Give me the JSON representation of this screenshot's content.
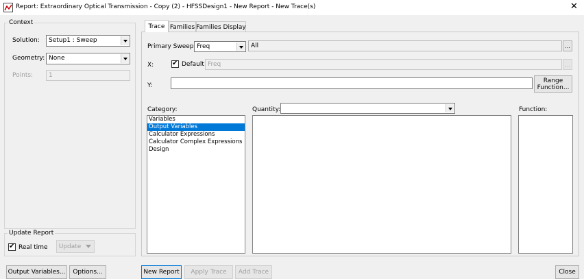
{
  "window": {
    "title": "Report: Extraordinary Optical Transmission - Copy (2) - HFSSDesign1 - New Report - New Trace(s)",
    "close_glyph": "✕",
    "app_icon": "hfss-report-icon"
  },
  "context": {
    "legend": "Context",
    "solution_label": "Solution:",
    "solution_value": "Setup1 : Sweep",
    "geometry_label": "Geometry:",
    "geometry_value": "None",
    "points_label": "Points:",
    "points_value": "1"
  },
  "update_report": {
    "legend": "Update Report",
    "realtime_label": "Real time",
    "realtime_checked": true,
    "update_button": "Update"
  },
  "tabs": [
    {
      "label": "Trace",
      "active": true
    },
    {
      "label": "Families",
      "active": false
    },
    {
      "label": "Families Display",
      "active": false
    }
  ],
  "trace": {
    "primary_sweep_label": "Primary Sweep:",
    "primary_sweep_value": "Freq",
    "primary_sweep_range": "All",
    "ellipsis": "...",
    "x_label": "X:",
    "x_default_label": "Default",
    "x_default_checked": true,
    "x_value": "Freq",
    "y_label": "Y:",
    "y_value": "",
    "range_function_line1": "Range",
    "range_function_line2": "Function...",
    "category_label": "Category:",
    "categories": [
      "Variables",
      "Output Variables",
      "Calculator Expressions",
      "Calculator Complex Expressions",
      "Design"
    ],
    "selected_category_index": 1,
    "quantity_label": "Quantity:",
    "quantity_value": "",
    "function_label": "Function:"
  },
  "bottom": {
    "output_variables_button": "Output Variables...",
    "options_button": "Options...",
    "new_report_button": "New Report",
    "apply_trace_button": "Apply Trace",
    "add_trace_button": "Add Trace",
    "close_button": "Close"
  }
}
